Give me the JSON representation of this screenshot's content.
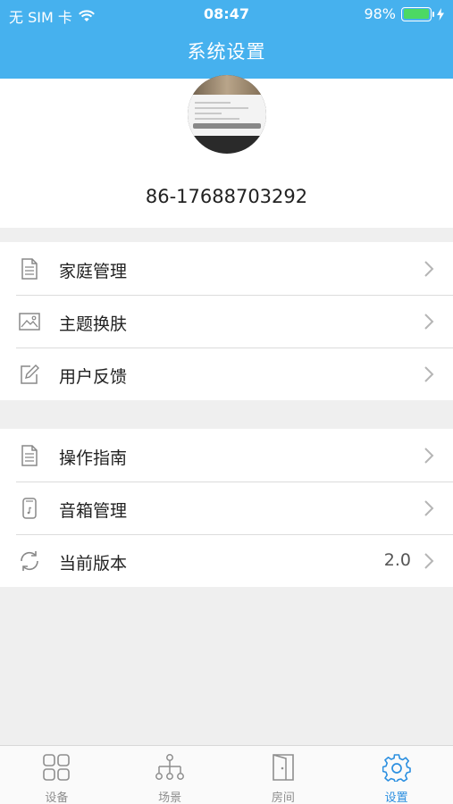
{
  "status_bar": {
    "carrier": "无 SIM 卡",
    "time": "08:47",
    "battery_percent": "98%",
    "battery_level": 0.98,
    "battery_color": "#4cd964"
  },
  "header": {
    "title": "系统设置",
    "background": "#46b1ee"
  },
  "profile": {
    "phone": "86-17688703292"
  },
  "menu_groups": [
    {
      "items": [
        {
          "label": "家庭管理",
          "icon": "document-icon"
        },
        {
          "label": "主题换肤",
          "icon": "image-icon"
        },
        {
          "label": "用户反馈",
          "icon": "edit-icon"
        }
      ]
    },
    {
      "items": [
        {
          "label": "操作指南",
          "icon": "document-icon"
        },
        {
          "label": "音箱管理",
          "icon": "speaker-icon"
        },
        {
          "label": "当前版本",
          "icon": "refresh-icon",
          "value": "2.0"
        }
      ]
    }
  ],
  "tabbar": {
    "active_color": "#2b8fe0",
    "tabs": [
      {
        "label": "设备",
        "icon": "grid-icon",
        "active": false
      },
      {
        "label": "场景",
        "icon": "hierarchy-icon",
        "active": false
      },
      {
        "label": "房间",
        "icon": "door-icon",
        "active": false
      },
      {
        "label": "设置",
        "icon": "gear-icon",
        "active": true
      }
    ]
  }
}
